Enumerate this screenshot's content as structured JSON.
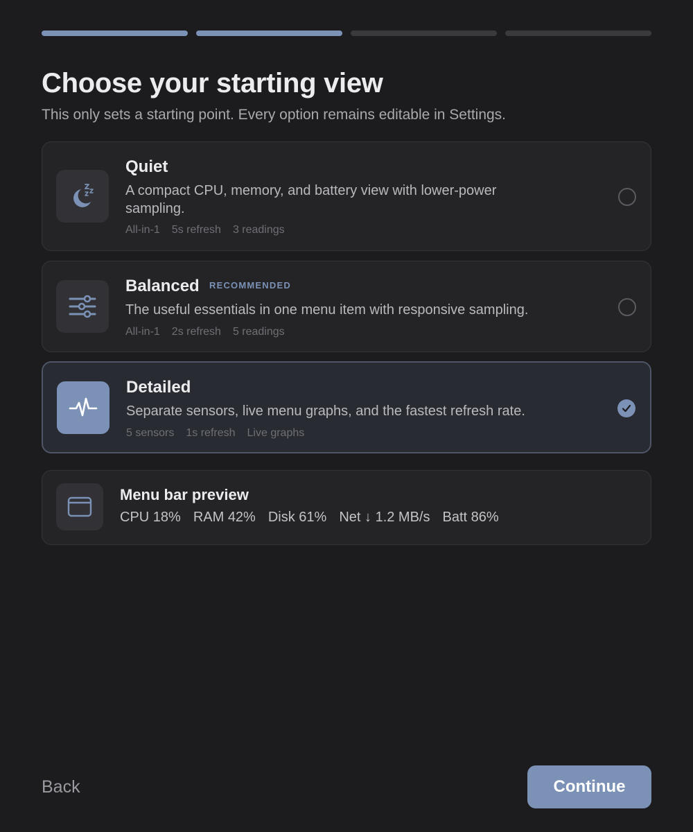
{
  "header": {
    "title": "Choose your starting view",
    "subtitle": "This only sets a starting point. Every option remains editable in Settings."
  },
  "progress": {
    "total_steps": 4,
    "completed_steps": 2
  },
  "options": [
    {
      "name": "Quiet",
      "badge": "",
      "description": "A compact CPU, memory, and battery view with lower-power sampling.",
      "meta": [
        "All-in-1",
        "5s refresh",
        "3 readings"
      ],
      "icon": "moon-sleep-icon",
      "selected": false
    },
    {
      "name": "Balanced",
      "badge": "RECOMMENDED",
      "description": "The useful essentials in one menu item with responsive sampling.",
      "meta": [
        "All-in-1",
        "2s refresh",
        "5 readings"
      ],
      "icon": "sliders-icon",
      "selected": false
    },
    {
      "name": "Detailed",
      "badge": "",
      "description": "Separate sensors, live menu graphs, and the fastest refresh rate.",
      "meta": [
        "5 sensors",
        "1s refresh",
        "Live graphs"
      ],
      "icon": "pulse-icon",
      "selected": true
    }
  ],
  "preview": {
    "label": "Menu bar preview",
    "icon": "window-icon",
    "values": [
      "CPU 18%",
      "RAM 42%",
      "Disk 61%",
      "Net ↓ 1.2 MB/s",
      "Batt 86%"
    ]
  },
  "footer": {
    "back_label": "Back",
    "continue_label": "Continue"
  },
  "colors": {
    "background": "#1c1c1e",
    "accent": "#7b92b6",
    "card": "#242427",
    "track": "#3a3a3e"
  }
}
